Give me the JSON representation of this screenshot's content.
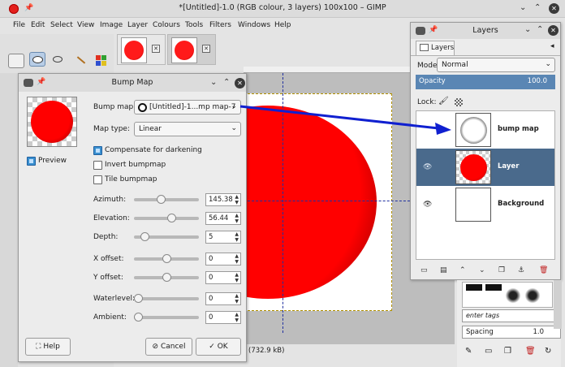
{
  "window": {
    "title": "*[Untitled]-1.0 (RGB colour, 3 layers) 100x100 – GIMP"
  },
  "menu": [
    "File",
    "Edit",
    "Select",
    "View",
    "Image",
    "Layer",
    "Colours",
    "Tools",
    "Filters",
    "Windows",
    "Help"
  ],
  "status": {
    "text": "(732.9 kB)"
  },
  "bump_dialog": {
    "title": "Bump Map",
    "preview_label": "Preview",
    "bump_map_label": "Bump map:",
    "bump_map_value": "[Untitled]-1...mp map-7",
    "map_type_label": "Map type:",
    "map_type_value": "Linear",
    "compensate_label": "Compensate for darkening",
    "invert_label": "Invert bumpmap",
    "tile_label": "Tile bumpmap",
    "azimuth_label": "Azimuth:",
    "azimuth_value": "145.38",
    "azimuth_pos": 0.4,
    "elevation_label": "Elevation:",
    "elevation_value": "56.44",
    "elevation_pos": 0.6,
    "depth_label": "Depth:",
    "depth_value": "5",
    "depth_pos": 0.12,
    "xoffset_label": "X offset:",
    "xoffset_value": "0",
    "xoffset_pos": 0.5,
    "yoffset_label": "Y offset:",
    "yoffset_value": "0",
    "yoffset_pos": 0.5,
    "waterlevel_label": "Waterlevel:",
    "waterlevel_value": "0",
    "waterlevel_pos": 0.0,
    "ambient_label": "Ambient:",
    "ambient_value": "0",
    "ambient_pos": 0.0,
    "help_label": "Help",
    "cancel_label": "Cancel",
    "ok_label": "OK"
  },
  "layers_dock": {
    "title": "Layers",
    "tab_label": "Layers",
    "mode_label": "Mode:",
    "mode_value": "Normal",
    "opacity_label": "Opacity",
    "opacity_value": "100.0",
    "lock_label": "Lock:",
    "layers": [
      {
        "name": "bump map",
        "visible": false,
        "selected": false
      },
      {
        "name": "Layer",
        "visible": true,
        "selected": true
      },
      {
        "name": "Background",
        "visible": true,
        "selected": false
      }
    ]
  },
  "brushes_dock": {
    "tags_placeholder": "enter tags",
    "spacing_label": "Spacing",
    "spacing_value": "1.0"
  },
  "colors": {
    "accent": "#5a86b4",
    "selected_row": "#4a6a8c",
    "arrow": "#1020d0"
  }
}
